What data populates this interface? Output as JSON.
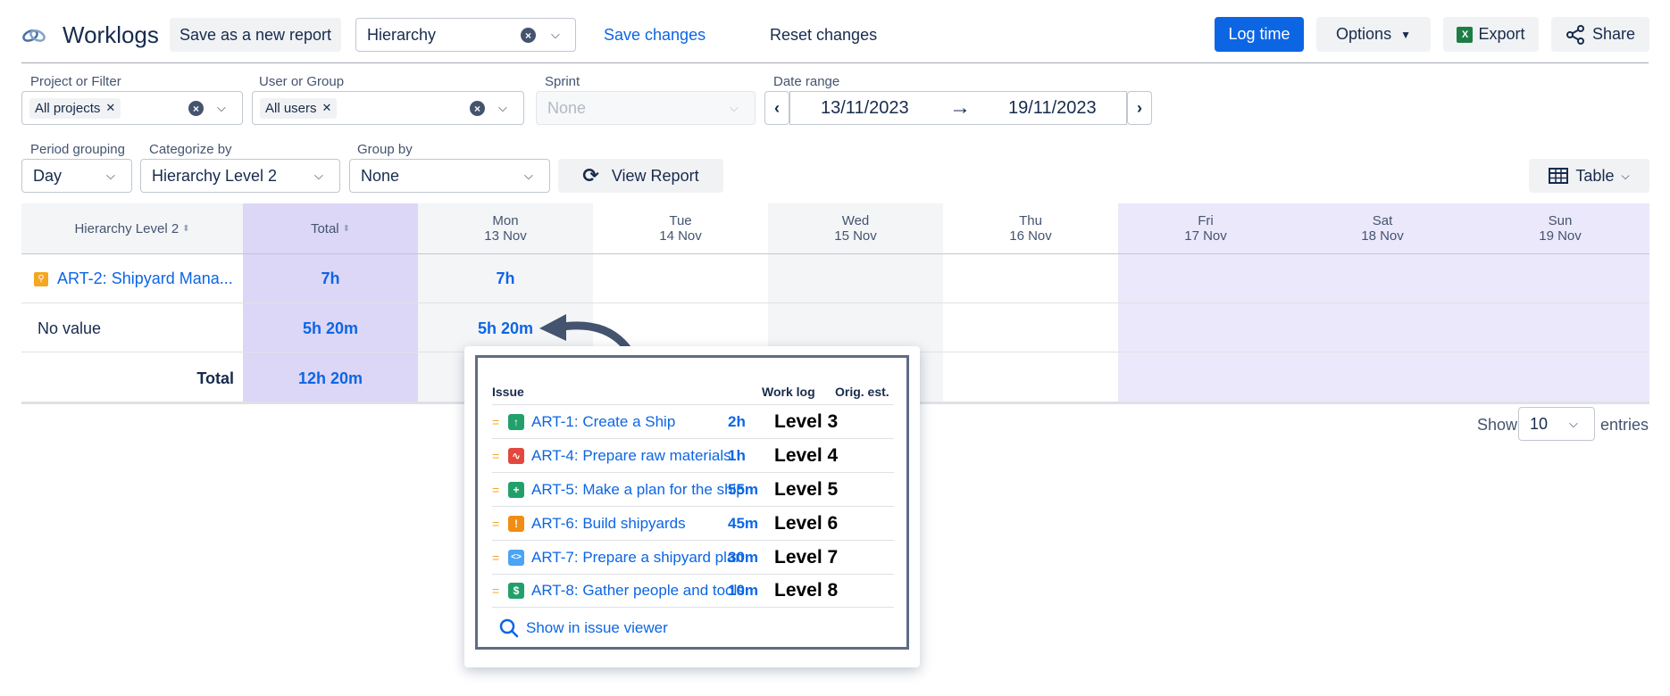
{
  "header": {
    "title": "Worklogs",
    "save_as_new": "Save as a new report",
    "report_select": "Hierarchy",
    "save_changes": "Save changes",
    "reset_changes": "Reset changes",
    "log_time": "Log time",
    "options": "Options",
    "export": "Export",
    "share": "Share"
  },
  "filters": {
    "project_label": "Project or Filter",
    "project_chip": "All projects",
    "user_label": "User or Group",
    "user_chip": "All users",
    "sprint_label": "Sprint",
    "sprint_value": "None",
    "date_label": "Date range",
    "date_from": "13/11/2023",
    "date_to": "19/11/2023",
    "period_label": "Period grouping",
    "period_value": "Day",
    "categorize_label": "Categorize by",
    "categorize_value": "Hierarchy Level 2",
    "group_label": "Group by",
    "group_value": "None",
    "view_report": "View Report",
    "view_mode": "Table"
  },
  "table": {
    "col_category": "Hierarchy Level 2",
    "col_total": "Total",
    "days": [
      {
        "name": "Mon",
        "date": "13 Nov"
      },
      {
        "name": "Tue",
        "date": "14 Nov"
      },
      {
        "name": "Wed",
        "date": "15 Nov"
      },
      {
        "name": "Thu",
        "date": "16 Nov"
      },
      {
        "name": "Fri",
        "date": "17 Nov"
      },
      {
        "name": "Sat",
        "date": "18 Nov"
      },
      {
        "name": "Sun",
        "date": "19 Nov"
      }
    ],
    "rows": [
      {
        "label": "ART-2: Shipyard Mana...",
        "total": "7h",
        "mon": "7h"
      },
      {
        "label": "No value",
        "total": "5h 20m",
        "mon": "5h 20m"
      }
    ],
    "total_label": "Total",
    "total_value": "12h 20m"
  },
  "pagination": {
    "show": "Show",
    "entries_value": "10",
    "entries": "entries"
  },
  "popup": {
    "col_issue": "Issue",
    "col_worklog": "Work log",
    "col_orig": "Orig. est.",
    "items": [
      {
        "issue": "ART-1: Create a Ship",
        "worklog": "2h",
        "level": "Level 3",
        "type_color": "#22a06b",
        "type_icon": "arrow-up-icon"
      },
      {
        "issue": "ART-4: Prepare raw materials",
        "worklog": "1h",
        "level": "Level 4",
        "type_color": "#e2483d",
        "type_icon": "pulse-icon"
      },
      {
        "issue": "ART-5: Make a plan for the ship",
        "worklog": "55m",
        "level": "Level 5",
        "type_color": "#22a06b",
        "type_icon": "plus-icon"
      },
      {
        "issue": "ART-6: Build shipyards",
        "worklog": "45m",
        "level": "Level 6",
        "type_color": "#f18d13",
        "type_icon": "exclamation-icon"
      },
      {
        "issue": "ART-7: Prepare a shipyard plan",
        "worklog": "30m",
        "level": "Level 7",
        "type_color": "#4ca4f5",
        "type_icon": "code-icon"
      },
      {
        "issue": "ART-8: Gather people and tools",
        "worklog": "10m",
        "level": "Level 8",
        "type_color": "#22a06b",
        "type_icon": "dollar-icon"
      }
    ],
    "show_in_viewer": "Show in issue viewer"
  },
  "colors": {
    "primary": "#0c66e4",
    "total_column": "#dcd6f7",
    "weekend_column": "#ebe8fb",
    "excel_green": "#1d7d45",
    "epic_orange": "#f5a623"
  }
}
